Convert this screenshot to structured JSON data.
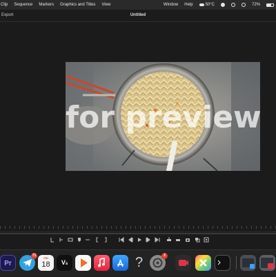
{
  "menubar": {
    "menus": [
      "Clip",
      "Sequence",
      "Markers",
      "Graphics and Titles",
      "View"
    ],
    "right_menus": [
      "Window",
      "Help"
    ],
    "temperature": "50°C",
    "battery": "72%",
    "battery_fraction": 0.72
  },
  "app": {
    "export_label": "Export",
    "project_title": "Untitled"
  },
  "preview": {
    "watermark_text": "for preview"
  },
  "dock": {
    "telegram_badge": "71",
    "calendar_month": "FRI",
    "calendar_day": "18",
    "settings_badge": "2",
    "question_glyph": "?"
  },
  "colors": {
    "menubar_bg": "#2a2a2a",
    "app_bg": "#1b1b1b",
    "badge_red": "#e03a2f",
    "premiere_purple": "#1d1a4f",
    "premiere_text": "#9f9bff"
  }
}
